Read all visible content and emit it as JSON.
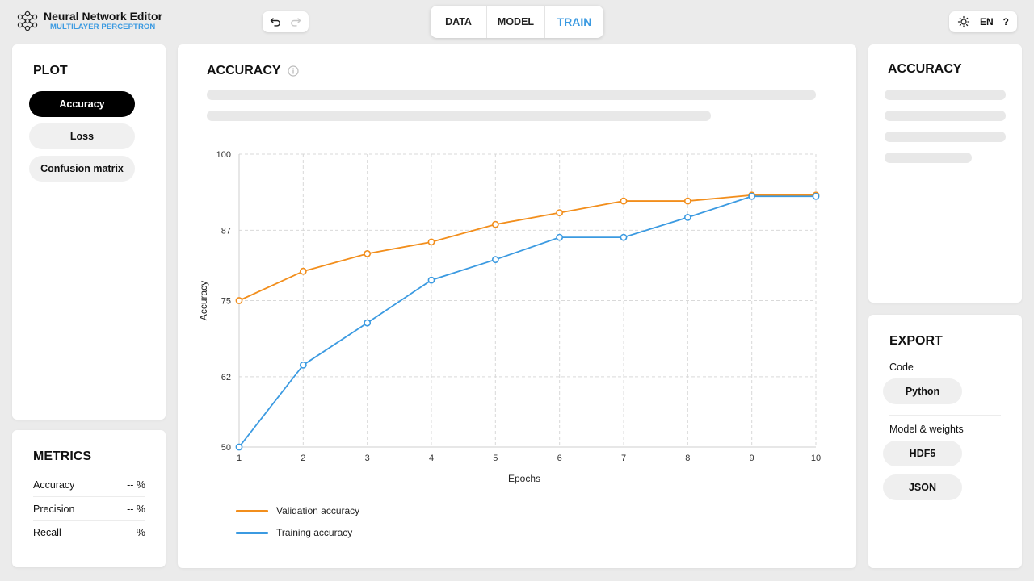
{
  "header": {
    "app_title": "Neural Network Editor",
    "app_subtitle": "MULTILAYER PERCEPTRON",
    "tabs": [
      {
        "label": "DATA",
        "active": false
      },
      {
        "label": "MODEL",
        "active": false
      },
      {
        "label": "TRAIN",
        "active": true
      }
    ],
    "language": "EN",
    "help": "?"
  },
  "plot_panel": {
    "title": "PLOT",
    "options": [
      {
        "label": "Accuracy",
        "active": true
      },
      {
        "label": "Loss",
        "active": false
      },
      {
        "label": "Confusion matrix",
        "active": false
      }
    ]
  },
  "metrics_panel": {
    "title": "METRICS",
    "rows": [
      {
        "label": "Accuracy",
        "value": "-- %"
      },
      {
        "label": "Precision",
        "value": "-- %"
      },
      {
        "label": "Recall",
        "value": "-- %"
      }
    ]
  },
  "main": {
    "title": "ACCURACY"
  },
  "accuracy_panel": {
    "title": "ACCURACY"
  },
  "export_panel": {
    "title": "EXPORT",
    "code_label": "Code",
    "code_buttons": [
      "Python"
    ],
    "weights_label": "Model & weights",
    "weights_buttons": [
      "HDF5",
      "JSON"
    ]
  },
  "colors": {
    "accent": "#3b9ae1",
    "validation": "#f28e1c",
    "training": "#3b9ae1"
  },
  "chart_data": {
    "type": "line",
    "xlabel": "Epochs",
    "ylabel": "Accuracy",
    "x": [
      1,
      2,
      3,
      4,
      5,
      6,
      7,
      8,
      9,
      10
    ],
    "xticks": [
      "1",
      "2",
      "3",
      "4",
      "5",
      "6",
      "7",
      "8",
      "9",
      "10"
    ],
    "yticks": [
      "50",
      "62",
      "75",
      "87",
      "100"
    ],
    "ylim": [
      50,
      100
    ],
    "grid": true,
    "legend_position": "bottom-left",
    "series": [
      {
        "name": "Validation accuracy",
        "color": "#f28e1c",
        "values": [
          75,
          80,
          83,
          85,
          88,
          90,
          92,
          92,
          93,
          93
        ]
      },
      {
        "name": "Training accuracy",
        "color": "#3b9ae1",
        "values": [
          50,
          64,
          71.2,
          78.5,
          82,
          85.8,
          85.8,
          89.2,
          92.8,
          92.8
        ]
      }
    ]
  }
}
